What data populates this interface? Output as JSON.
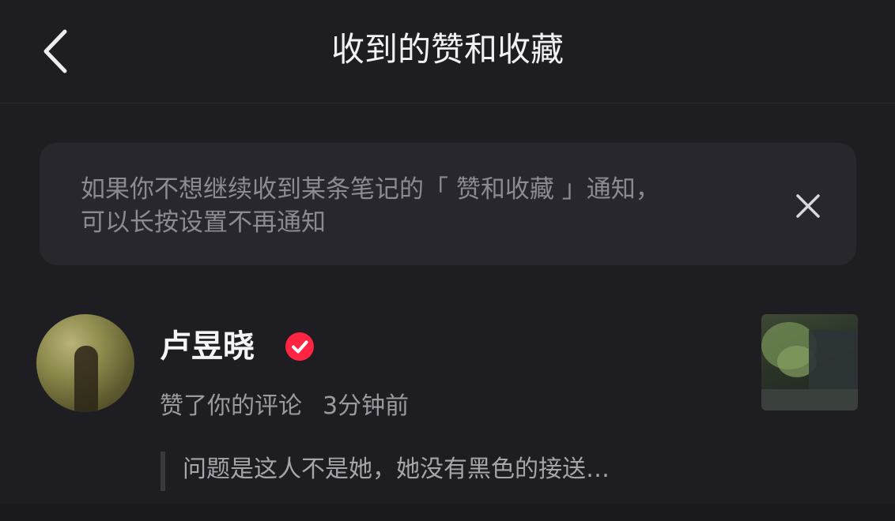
{
  "header": {
    "title": "收到的赞和收藏",
    "back_icon": "chevron-left-icon"
  },
  "notice": {
    "line1": "如果你不想继续收到某条笔记的「 赞和收藏 」通知，",
    "line2": "可以长按设置不再通知",
    "close_icon": "close-icon"
  },
  "notification": {
    "user_name": "卢昱晓",
    "verified_icon": "verified-badge-icon",
    "action": "赞了你的评论",
    "time": "3分钟前",
    "quote": "问题是这人不是她，她没有黑色的接送…"
  },
  "colors": {
    "background": "#1e1d22",
    "card": "#28272d",
    "badge": "#ff2442"
  }
}
